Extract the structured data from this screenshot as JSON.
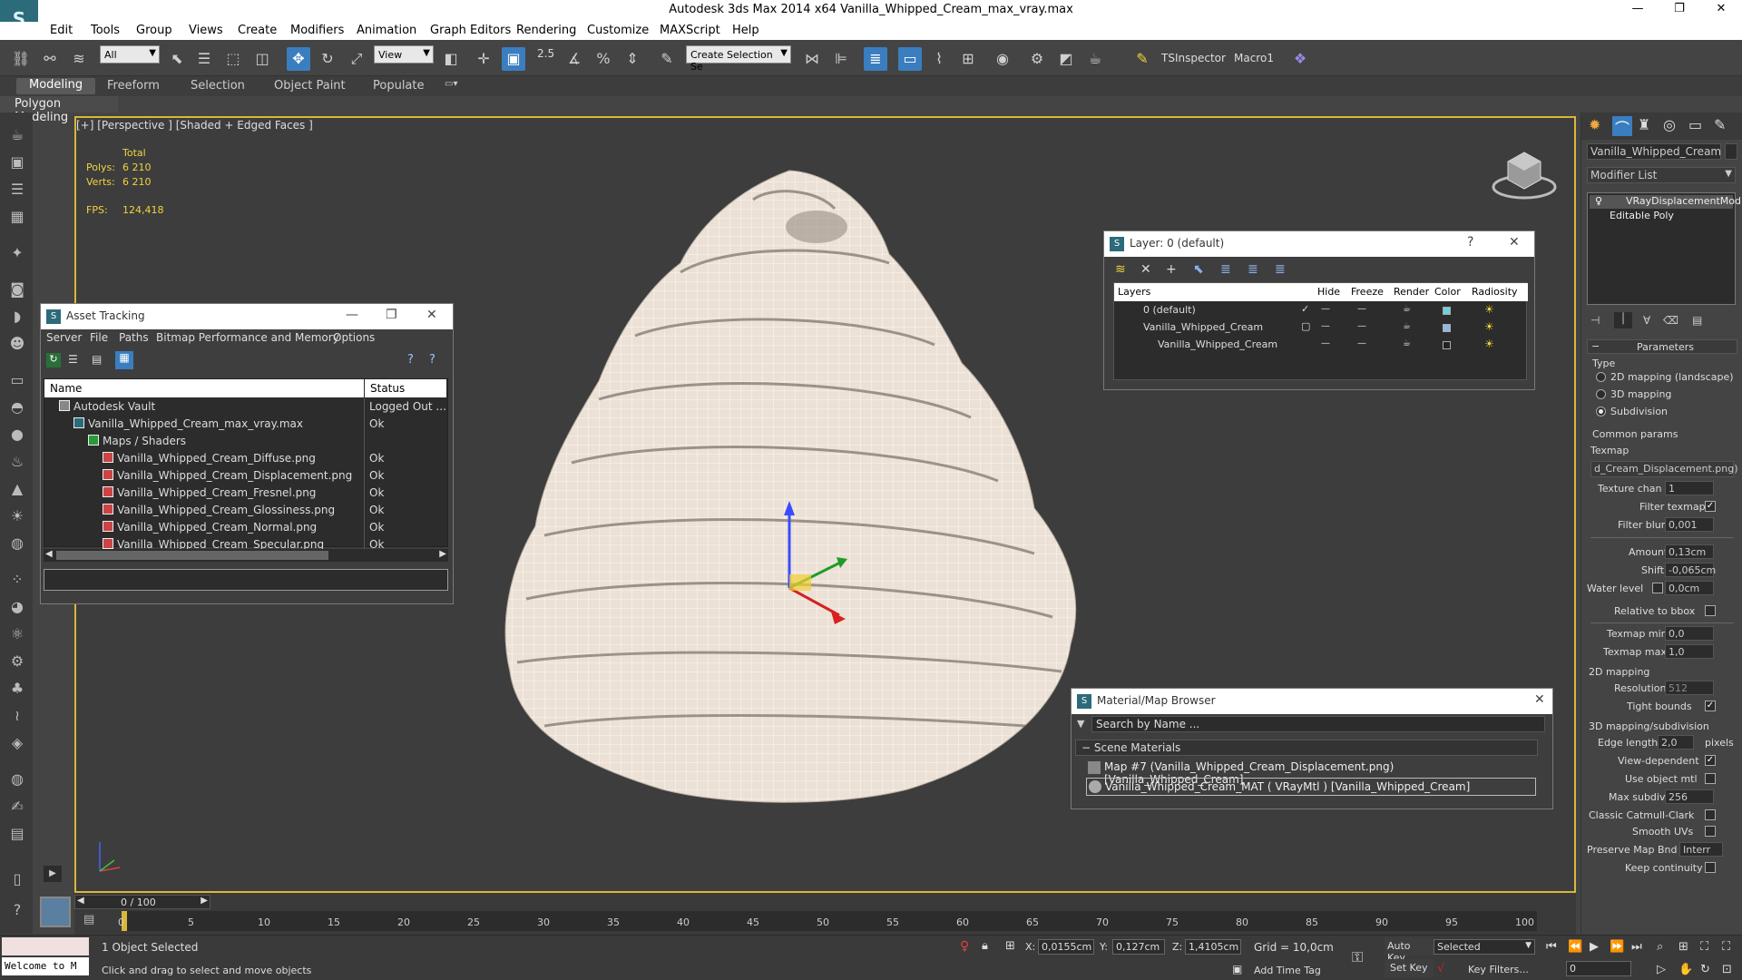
{
  "window": {
    "title": "Autodesk 3ds Max  2014 x64     Vanilla_Whipped_Cream_max_vray.max",
    "minimize": "—",
    "restore": "❐",
    "close": "✕"
  },
  "menu": [
    "Edit",
    "Tools",
    "Group",
    "Views",
    "Create",
    "Modifiers",
    "Animation",
    "Graph Editors",
    "Rendering",
    "Customize",
    "MAXScript",
    "Help"
  ],
  "toolbar": {
    "selection_filter": "All",
    "ref_coord": "View",
    "named_selection": "Create Selection Se",
    "angle_snap": "2.5",
    "ts_inspector": "TSInspector",
    "macro": "Macro1"
  },
  "ribbon": {
    "tabs": [
      "Modeling",
      "Freeform",
      "Selection",
      "Object Paint",
      "Populate"
    ],
    "sub": "Polygon Modeling"
  },
  "viewport": {
    "label": "[+] [Perspective ] [Shaded + Edged Faces ]",
    "stats_header": "Total",
    "polys_label": "Polys:",
    "polys_value": "6 210",
    "verts_label": "Verts:",
    "verts_value": "6 210",
    "fps_label": "FPS:",
    "fps_value": "124,418",
    "mesh_color": "#ece1d6"
  },
  "asset_tracking": {
    "title": "Asset Tracking",
    "menu": [
      "Server",
      "File",
      "Paths",
      "Bitmap Performance and Memory",
      "Options"
    ],
    "col_name": "Name",
    "col_status": "Status",
    "rows": [
      {
        "name": "Autodesk Vault",
        "status": "Logged Out ...",
        "indent": 0
      },
      {
        "name": "Vanilla_Whipped_Cream_max_vray.max",
        "status": "Ok",
        "indent": 1
      },
      {
        "name": "Maps / Shaders",
        "status": "",
        "indent": 2
      },
      {
        "name": "Vanilla_Whipped_Cream_Diffuse.png",
        "status": "Ok",
        "indent": 3
      },
      {
        "name": "Vanilla_Whipped_Cream_Displacement.png",
        "status": "Ok",
        "indent": 3
      },
      {
        "name": "Vanilla_Whipped_Cream_Fresnel.png",
        "status": "Ok",
        "indent": 3
      },
      {
        "name": "Vanilla_Whipped_Cream_Glossiness.png",
        "status": "Ok",
        "indent": 3
      },
      {
        "name": "Vanilla_Whipped_Cream_Normal.png",
        "status": "Ok",
        "indent": 3
      },
      {
        "name": "Vanilla_Whipped_Cream_Specular.png",
        "status": "Ok",
        "indent": 3
      }
    ]
  },
  "layer_panel": {
    "title": "Layer: 0 (default)",
    "help": "?",
    "cols": [
      "Layers",
      "Hide",
      "Freeze",
      "Render",
      "Color",
      "Radiosity"
    ],
    "rows": [
      {
        "name": "0 (default)",
        "color": "#6fd0d8"
      },
      {
        "name": "Vanilla_Whipped_Cream",
        "color": "#8fb8e8"
      },
      {
        "name": "Vanilla_Whipped_Cream",
        "color": "#222222"
      }
    ]
  },
  "material_browser": {
    "title": "Material/Map Browser",
    "search_placeholder": "Search by Name ...",
    "section": "Scene Materials",
    "items": [
      "Map #7 (Vanilla_Whipped_Cream_Displacement.png) [Vanilla_Whipped_Cream]",
      "Vanilla_Whipped_Cream_MAT ( VRayMtl ) [Vanilla_Whipped_Cream]"
    ]
  },
  "command_panel": {
    "object_name": "Vanilla_Whipped_Cream",
    "modifier_list": "Modifier List",
    "stack": [
      "VRayDisplacementMod",
      "Editable Poly"
    ],
    "parameters": "Parameters",
    "type_label": "Type",
    "type_options": [
      "2D mapping (landscape)",
      "3D mapping",
      "Subdivision"
    ],
    "common_params": "Common params",
    "texmap_label": "Texmap",
    "texmap_value": "d_Cream_Displacement.png)",
    "texture_chan_label": "Texture chan",
    "texture_chan_value": "1",
    "filter_texmap": "Filter texmap",
    "filter_blur_label": "Filter blur",
    "filter_blur_value": "0,001",
    "amount_label": "Amount",
    "amount_value": "0,13cm",
    "shift_label": "Shift",
    "shift_value": "-0,065cm",
    "water_level_label": "Water level",
    "water_level_value": "0,0cm",
    "relative_bbox": "Relative to bbox",
    "texmap_min_label": "Texmap min",
    "texmap_min_value": "0,0",
    "texmap_max_label": "Texmap max",
    "texmap_max_value": "1,0",
    "mapping2d": "2D mapping",
    "resolution_label": "Resolution",
    "resolution_value": "512",
    "tight_bounds": "Tight bounds",
    "mapping3d": "3D mapping/subdivision",
    "edge_length_label": "Edge length",
    "edge_length_value": "2,0",
    "pixels": "pixels",
    "view_dependent": "View-dependent",
    "use_object_mtl": "Use object mtl",
    "max_subdivs_label": "Max subdivs",
    "max_subdivs_value": "256",
    "classic_cc": "Classic Catmull-Clark",
    "smooth_uvs": "Smooth UVs",
    "preserve_map_label": "Preserve Map Bnd",
    "preserve_map_value": "Interr",
    "keep_continuity": "Keep continuity"
  },
  "timeline": {
    "frame": "0 / 100",
    "ticks": [
      "0",
      "5",
      "10",
      "15",
      "20",
      "25",
      "30",
      "35",
      "40",
      "45",
      "50",
      "55",
      "60",
      "65",
      "70",
      "75",
      "80",
      "85",
      "90",
      "95",
      "100"
    ]
  },
  "status": {
    "maxscript": "Welcome to M",
    "selected": "1 Object Selected",
    "prompt": "Click and drag to select and move objects",
    "x_label": "X:",
    "x": "0,0155cm",
    "y_label": "Y:",
    "y": "0,127cm",
    "z_label": "Z:",
    "z": "1,4105cm",
    "grid": "Grid = 10,0cm",
    "add_time_tag": "Add Time Tag",
    "auto_key": "Auto Key",
    "set_key": "Set Key",
    "key_mode": "Selected",
    "key_filters": "Key Filters...",
    "frame_field": "0"
  }
}
